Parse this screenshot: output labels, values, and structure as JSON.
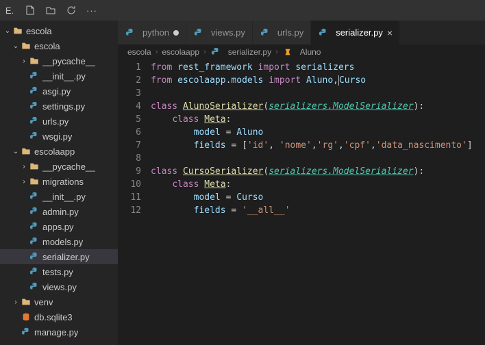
{
  "titlebar": {
    "letter": "E."
  },
  "sidebar": {
    "root": "escola",
    "items": [
      {
        "label": "escola",
        "depth": 0,
        "type": "folder-open",
        "chev": "down"
      },
      {
        "label": "escola",
        "depth": 1,
        "type": "folder-open",
        "chev": "down"
      },
      {
        "label": "__pycache__",
        "depth": 2,
        "type": "folder",
        "chev": "right"
      },
      {
        "label": "__init__.py",
        "depth": 2,
        "type": "py"
      },
      {
        "label": "asgi.py",
        "depth": 2,
        "type": "py"
      },
      {
        "label": "settings.py",
        "depth": 2,
        "type": "py"
      },
      {
        "label": "urls.py",
        "depth": 2,
        "type": "py"
      },
      {
        "label": "wsgi.py",
        "depth": 2,
        "type": "py"
      },
      {
        "label": "escolaapp",
        "depth": 1,
        "type": "folder-open",
        "chev": "down"
      },
      {
        "label": "__pycache__",
        "depth": 2,
        "type": "folder",
        "chev": "right"
      },
      {
        "label": "migrations",
        "depth": 2,
        "type": "folder",
        "chev": "right"
      },
      {
        "label": "__init__.py",
        "depth": 2,
        "type": "py"
      },
      {
        "label": "admin.py",
        "depth": 2,
        "type": "py"
      },
      {
        "label": "apps.py",
        "depth": 2,
        "type": "py"
      },
      {
        "label": "models.py",
        "depth": 2,
        "type": "py"
      },
      {
        "label": "serializer.py",
        "depth": 2,
        "type": "py",
        "active": true
      },
      {
        "label": "tests.py",
        "depth": 2,
        "type": "py"
      },
      {
        "label": "views.py",
        "depth": 2,
        "type": "py"
      },
      {
        "label": "venv",
        "depth": 1,
        "type": "folder",
        "chev": "right"
      },
      {
        "label": "db.sqlite3",
        "depth": 1,
        "type": "db"
      },
      {
        "label": "manage.py",
        "depth": 1,
        "type": "py"
      }
    ]
  },
  "tabs": [
    {
      "label": "python",
      "modified": true,
      "icon": "py"
    },
    {
      "label": "views.py",
      "icon": "py"
    },
    {
      "label": "urls.py",
      "icon": "py"
    },
    {
      "label": "serializer.py",
      "active": true,
      "icon": "py"
    }
  ],
  "breadcrumb": [
    "escola",
    "escolaapp",
    "serializer.py",
    "Aluno"
  ],
  "code": {
    "lines": [
      {
        "n": 1,
        "tokens": [
          [
            "kw",
            "from"
          ],
          [
            "txt",
            " "
          ],
          [
            "var",
            "rest_framework"
          ],
          [
            "txt",
            " "
          ],
          [
            "kw",
            "import"
          ],
          [
            "txt",
            " "
          ],
          [
            "var",
            "serializers"
          ]
        ]
      },
      {
        "n": 2,
        "tokens": [
          [
            "kw",
            "from"
          ],
          [
            "txt",
            " "
          ],
          [
            "var",
            "escolaapp"
          ],
          [
            "txt",
            "."
          ],
          [
            "var",
            "models"
          ],
          [
            "txt",
            " "
          ],
          [
            "kw",
            "import"
          ],
          [
            "txt",
            " "
          ],
          [
            "var",
            "Aluno"
          ],
          [
            "txt",
            ","
          ],
          [
            "cursor",
            ""
          ],
          [
            "var",
            "Curso"
          ]
        ]
      },
      {
        "n": 3,
        "tokens": []
      },
      {
        "n": 4,
        "tokens": [
          [
            "kw",
            "class"
          ],
          [
            "txt",
            " "
          ],
          [
            "fn",
            "AlunoSerializer"
          ],
          [
            "txt",
            "("
          ],
          [
            "cls",
            "serializers.ModelSerializer"
          ],
          [
            "txt",
            "):"
          ]
        ]
      },
      {
        "n": 5,
        "tokens": [
          [
            "txt",
            "    "
          ],
          [
            "kw",
            "class"
          ],
          [
            "txt",
            " "
          ],
          [
            "fn",
            "Meta"
          ],
          [
            "txt",
            ":"
          ]
        ]
      },
      {
        "n": 6,
        "tokens": [
          [
            "txt",
            "        "
          ],
          [
            "var2",
            "model"
          ],
          [
            "txt",
            " = "
          ],
          [
            "var",
            "Aluno"
          ]
        ]
      },
      {
        "n": 7,
        "tokens": [
          [
            "txt",
            "        "
          ],
          [
            "var2",
            "fields"
          ],
          [
            "txt",
            " = ["
          ],
          [
            "str",
            "'id'"
          ],
          [
            "txt",
            ", "
          ],
          [
            "str",
            "'nome'"
          ],
          [
            "txt",
            ","
          ],
          [
            "str",
            "'rg'"
          ],
          [
            "txt",
            ","
          ],
          [
            "str",
            "'cpf'"
          ],
          [
            "txt",
            ","
          ],
          [
            "str",
            "'data_nascimento'"
          ],
          [
            "txt",
            "]"
          ]
        ]
      },
      {
        "n": 8,
        "tokens": []
      },
      {
        "n": 9,
        "tokens": [
          [
            "kw",
            "class"
          ],
          [
            "txt",
            " "
          ],
          [
            "fn",
            "CursoSerializer"
          ],
          [
            "txt",
            "("
          ],
          [
            "cls",
            "serializers.ModelSerializer"
          ],
          [
            "txt",
            "):"
          ]
        ]
      },
      {
        "n": 10,
        "tokens": [
          [
            "txt",
            "    "
          ],
          [
            "kw",
            "class"
          ],
          [
            "txt",
            " "
          ],
          [
            "fn",
            "Meta"
          ],
          [
            "txt",
            ":"
          ]
        ]
      },
      {
        "n": 11,
        "tokens": [
          [
            "txt",
            "        "
          ],
          [
            "var2",
            "model"
          ],
          [
            "txt",
            " = "
          ],
          [
            "var",
            "Curso"
          ]
        ]
      },
      {
        "n": 12,
        "tokens": [
          [
            "txt",
            "        "
          ],
          [
            "var2",
            "fields"
          ],
          [
            "txt",
            " = "
          ],
          [
            "str",
            "'__all__'"
          ]
        ]
      }
    ]
  }
}
